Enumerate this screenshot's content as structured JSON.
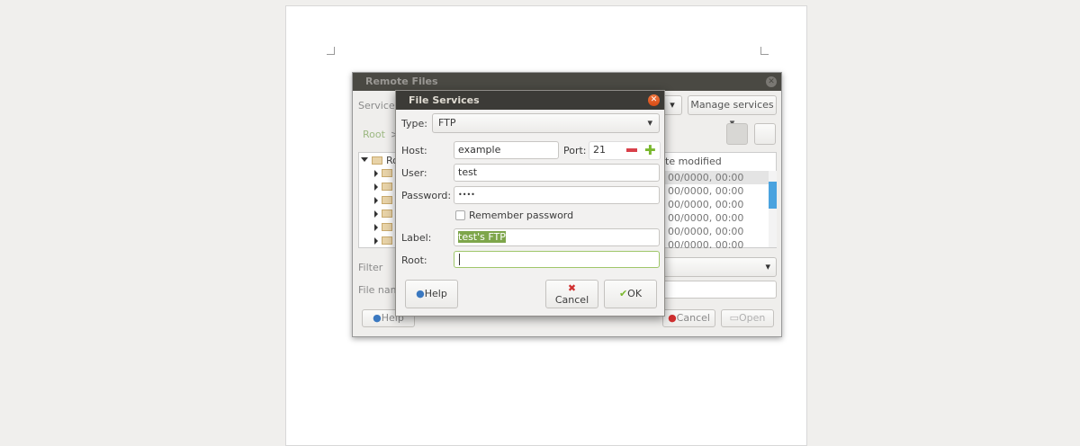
{
  "remote_files": {
    "title": "Remote Files",
    "service_label": "Service:",
    "manage_services": "Manage services",
    "breadcrumb_root": "Root",
    "breadcrumb_sep": ">",
    "tree_root": "Ro",
    "column_date": "te modified",
    "dates": [
      "00/0000, 00:00",
      "00/0000, 00:00",
      "00/0000, 00:00",
      "00/0000, 00:00",
      "00/0000, 00:00",
      "00/0000, 00:00"
    ],
    "filter_label": "Filter",
    "filename_label": "File name",
    "help": "Help",
    "cancel": "Cancel",
    "open": "Open"
  },
  "file_services": {
    "title": "File Services",
    "type_label": "Type:",
    "type_value": "FTP",
    "host_label": "Host:",
    "host_value": "example",
    "port_label": "Port:",
    "port_value": "21",
    "user_label": "User:",
    "user_value": "test",
    "password_label": "Password:",
    "password_value": "••••",
    "remember_label": "Remember password",
    "label_label": "Label:",
    "label_value": "test's FTP",
    "root_label": "Root:",
    "root_value": "",
    "help": "Help",
    "cancel": "Cancel",
    "ok": "OK"
  }
}
